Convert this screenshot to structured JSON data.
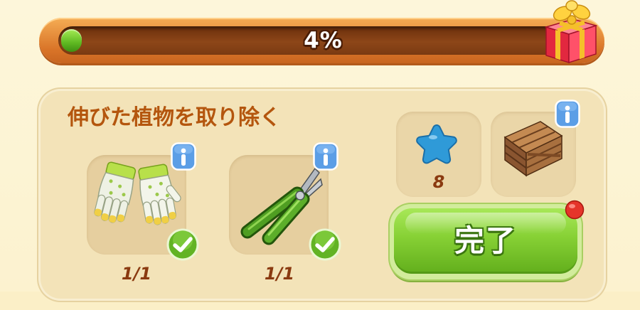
{
  "progress": {
    "label": "4%",
    "value": 0.04
  },
  "reward_chest": {
    "icon": "gift-box-icon"
  },
  "task": {
    "title": "伸びた植物を取り除く",
    "requirements": [
      {
        "icon": "gloves-icon",
        "count": "1/1",
        "done": true
      },
      {
        "icon": "pruning-shears-icon",
        "count": "1/1",
        "done": true
      }
    ]
  },
  "rewards": [
    {
      "icon": "blue-star-icon",
      "amount": "8"
    },
    {
      "icon": "wooden-crate-icon"
    }
  ],
  "complete_button": {
    "label": "完了",
    "has_notification": true
  },
  "colors": {
    "title": "#b4560e",
    "count": "#8a3a10",
    "button": "#86d034",
    "info": "#5b9ee6",
    "badge": "#e5342a"
  }
}
